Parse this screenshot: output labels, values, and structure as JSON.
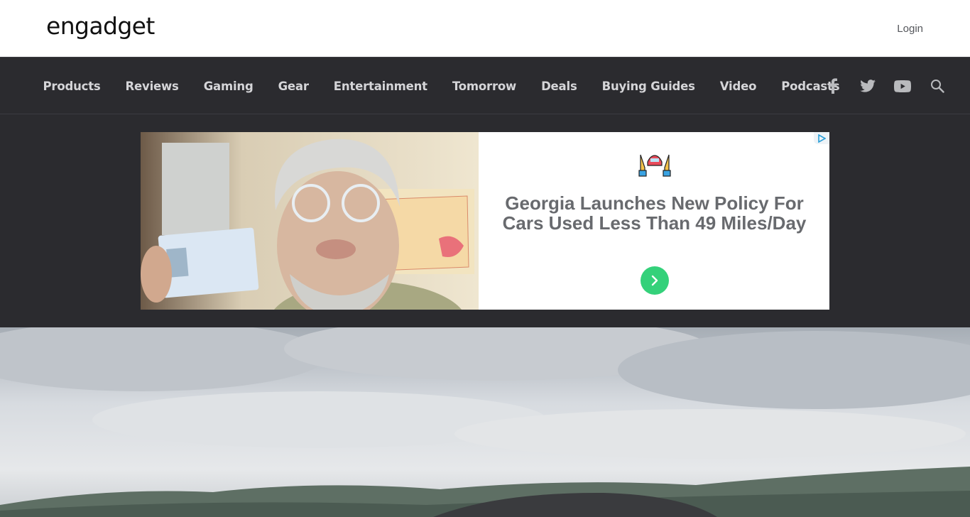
{
  "header": {
    "logo_text": "engadget",
    "login_label": "Login"
  },
  "nav": {
    "items": [
      {
        "label": "Products"
      },
      {
        "label": "Reviews"
      },
      {
        "label": "Gaming"
      },
      {
        "label": "Gear"
      },
      {
        "label": "Entertainment"
      },
      {
        "label": "Tomorrow"
      },
      {
        "label": "Deals"
      },
      {
        "label": "Buying Guides"
      },
      {
        "label": "Video"
      },
      {
        "label": "Podcasts"
      }
    ],
    "social_icons": [
      "facebook-icon",
      "twitter-icon",
      "youtube-icon",
      "search-icon"
    ]
  },
  "ad": {
    "headline": "Georgia Launches New Policy For Cars Used Less Than 49 Miles/Day",
    "icon": "hands-holding-car-icon",
    "cta_icon": "chevron-right-icon",
    "adchoices_icon": "adchoices-icon",
    "cta_color": "#34d17a"
  },
  "colors": {
    "nav_bg": "#2b2b2f",
    "nav_text": "#d5d5d8",
    "headline_text": "#686a6e"
  }
}
